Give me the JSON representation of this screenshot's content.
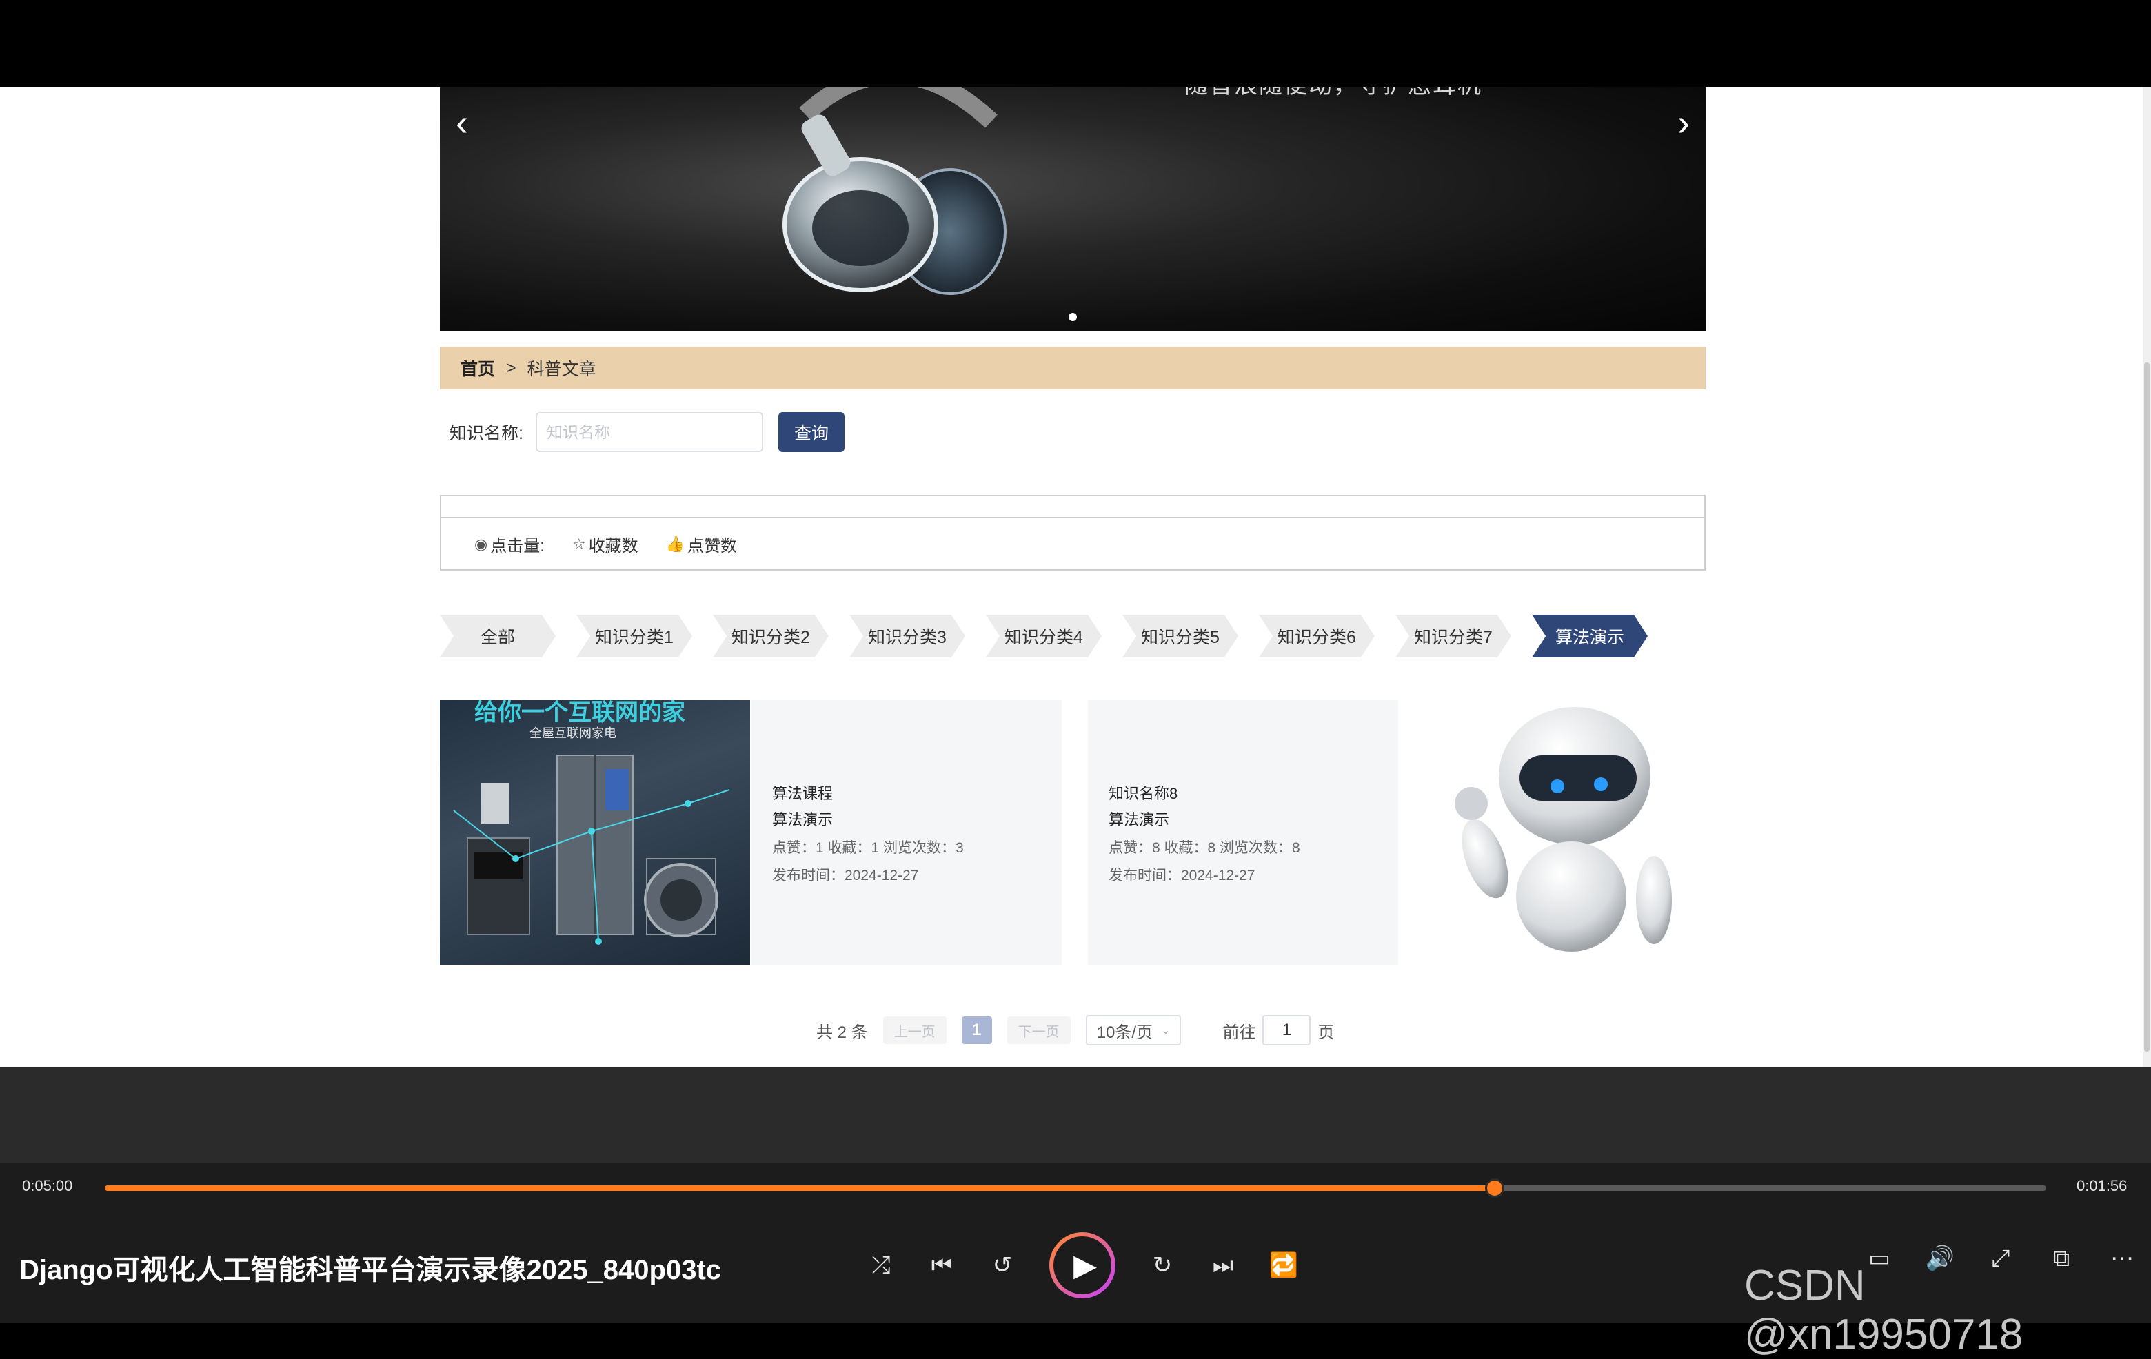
{
  "banner": {
    "caption": "随音浪随便动，守护您耳机"
  },
  "breadcrumb": {
    "home": "首页",
    "separator": ">",
    "current": "科普文章"
  },
  "search": {
    "label": "知识名称:",
    "placeholder": "知识名称",
    "button": "查询"
  },
  "sort": {
    "clicks": "点击量:",
    "favorites": "收藏数",
    "likes": "点赞数"
  },
  "categories": [
    "全部",
    "知识分类1",
    "知识分类2",
    "知识分类3",
    "知识分类4",
    "知识分类5",
    "知识分类6",
    "知识分类7",
    "算法演示"
  ],
  "active_category": "算法演示",
  "cards": [
    {
      "image_heading": "给你一个互联网的家",
      "image_sub": "全屋互联网家电",
      "title": "算法课程",
      "category": "算法演示",
      "stats": "点赞：1  收藏：1  浏览次数：3",
      "date": "发布时间：2024-12-27"
    },
    {
      "title": "知识名称8",
      "category": "算法演示",
      "stats": "点赞：8  收藏：8  浏览次数：8",
      "date": "发布时间：2024-12-27"
    }
  ],
  "pager": {
    "total": "共 2 条",
    "prev": "上一页",
    "current": "1",
    "next": "下一页",
    "size": "10条/页",
    "goto_prefix": "前往",
    "goto_value": "1",
    "goto_suffix": "页"
  },
  "player": {
    "elapsed": "0:05:00",
    "remaining": "0:01:56",
    "progress": 0.716,
    "title": "Django可视化人工智能科普平台演示录像2025_840p03tc",
    "accent": "#ff7b1c"
  },
  "watermark": "CSDN @xn19950718"
}
